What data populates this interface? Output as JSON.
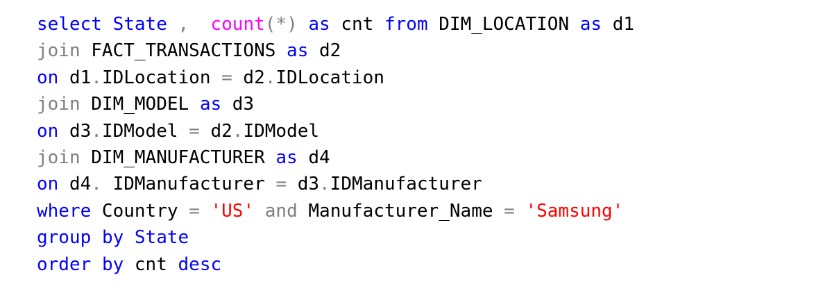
{
  "colors": {
    "keyword": "#0000ff",
    "function": "#ff00ff",
    "operator": "#808080",
    "string": "#ff0000",
    "identifier": "#000000"
  },
  "lines": [
    [
      {
        "t": "select",
        "k": "kw"
      },
      {
        "t": " ",
        "k": "id"
      },
      {
        "t": "State",
        "k": "kw"
      },
      {
        "t": " ",
        "k": "id"
      },
      {
        "t": ",",
        "k": "op"
      },
      {
        "t": "  ",
        "k": "id"
      },
      {
        "t": "count",
        "k": "fn"
      },
      {
        "t": "(*)",
        "k": "op"
      },
      {
        "t": " ",
        "k": "id"
      },
      {
        "t": "as",
        "k": "kw"
      },
      {
        "t": " cnt ",
        "k": "id"
      },
      {
        "t": "from",
        "k": "kw"
      },
      {
        "t": " DIM_LOCATION ",
        "k": "id"
      },
      {
        "t": "as",
        "k": "kw"
      },
      {
        "t": " d1",
        "k": "id"
      }
    ],
    [
      {
        "t": "join",
        "k": "op"
      },
      {
        "t": " FACT_TRANSACTIONS ",
        "k": "id"
      },
      {
        "t": "as",
        "k": "kw"
      },
      {
        "t": " d2",
        "k": "id"
      }
    ],
    [
      {
        "t": "on",
        "k": "kw"
      },
      {
        "t": " d1",
        "k": "id"
      },
      {
        "t": ".",
        "k": "op"
      },
      {
        "t": "IDLocation ",
        "k": "id"
      },
      {
        "t": "=",
        "k": "op"
      },
      {
        "t": " d2",
        "k": "id"
      },
      {
        "t": ".",
        "k": "op"
      },
      {
        "t": "IDLocation",
        "k": "id"
      }
    ],
    [
      {
        "t": "join",
        "k": "op"
      },
      {
        "t": " DIM_MODEL ",
        "k": "id"
      },
      {
        "t": "as",
        "k": "kw"
      },
      {
        "t": " d3",
        "k": "id"
      }
    ],
    [
      {
        "t": "on",
        "k": "kw"
      },
      {
        "t": " d3",
        "k": "id"
      },
      {
        "t": ".",
        "k": "op"
      },
      {
        "t": "IDModel ",
        "k": "id"
      },
      {
        "t": "=",
        "k": "op"
      },
      {
        "t": " d2",
        "k": "id"
      },
      {
        "t": ".",
        "k": "op"
      },
      {
        "t": "IDModel",
        "k": "id"
      }
    ],
    [
      {
        "t": "join",
        "k": "op"
      },
      {
        "t": " DIM_MANUFACTURER ",
        "k": "id"
      },
      {
        "t": "as",
        "k": "kw"
      },
      {
        "t": " d4",
        "k": "id"
      }
    ],
    [
      {
        "t": "on",
        "k": "kw"
      },
      {
        "t": " d4",
        "k": "id"
      },
      {
        "t": ".",
        "k": "op"
      },
      {
        "t": " IDManufacturer ",
        "k": "id"
      },
      {
        "t": "=",
        "k": "op"
      },
      {
        "t": " d3",
        "k": "id"
      },
      {
        "t": ".",
        "k": "op"
      },
      {
        "t": "IDManufacturer",
        "k": "id"
      }
    ],
    [
      {
        "t": "where",
        "k": "kw"
      },
      {
        "t": " Country ",
        "k": "id"
      },
      {
        "t": "=",
        "k": "op"
      },
      {
        "t": " ",
        "k": "id"
      },
      {
        "t": "'US'",
        "k": "str"
      },
      {
        "t": " ",
        "k": "id"
      },
      {
        "t": "and",
        "k": "op"
      },
      {
        "t": " Manufacturer_Name ",
        "k": "id"
      },
      {
        "t": "=",
        "k": "op"
      },
      {
        "t": " ",
        "k": "id"
      },
      {
        "t": "'Samsung'",
        "k": "str"
      }
    ],
    [
      {
        "t": "group",
        "k": "kw"
      },
      {
        "t": " ",
        "k": "id"
      },
      {
        "t": "by",
        "k": "kw"
      },
      {
        "t": " ",
        "k": "id"
      },
      {
        "t": "State",
        "k": "kw"
      }
    ],
    [
      {
        "t": "order",
        "k": "kw"
      },
      {
        "t": " ",
        "k": "id"
      },
      {
        "t": "by",
        "k": "kw"
      },
      {
        "t": " cnt ",
        "k": "id"
      },
      {
        "t": "desc",
        "k": "kw"
      }
    ]
  ]
}
